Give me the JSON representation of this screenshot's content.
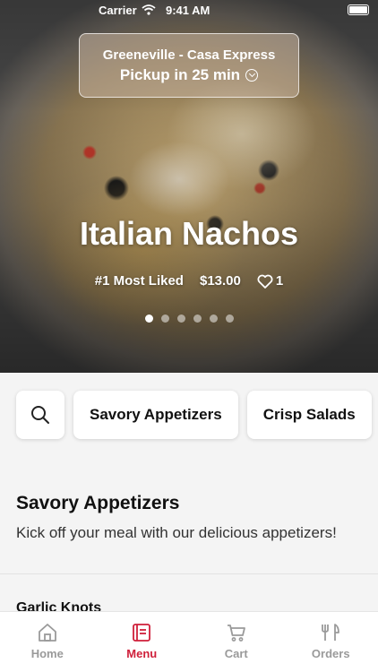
{
  "status_bar": {
    "carrier": "Carrier",
    "time": "9:41 AM"
  },
  "location": {
    "name": "Greeneville - Casa Express",
    "pickup": "Pickup in 25 min"
  },
  "featured": {
    "title": "Italian Nachos",
    "badge": "#1 Most Liked",
    "price": "$13.00",
    "likes": "1",
    "slide_count": 6,
    "active_slide": 1
  },
  "filters": {
    "chips": [
      "Savory Appetizers",
      "Crisp Salads"
    ]
  },
  "section": {
    "title": "Savory Appetizers",
    "description": "Kick off your meal with our delicious appetizers!"
  },
  "menu_items": [
    "Garlic Knots"
  ],
  "tabs": [
    {
      "label": "Home",
      "icon": "home-icon"
    },
    {
      "label": "Menu",
      "icon": "menu-icon"
    },
    {
      "label": "Cart",
      "icon": "cart-icon"
    },
    {
      "label": "Orders",
      "icon": "orders-icon"
    }
  ],
  "colors": {
    "accent": "#cf1f3a",
    "inactive": "#9a9a9a"
  }
}
